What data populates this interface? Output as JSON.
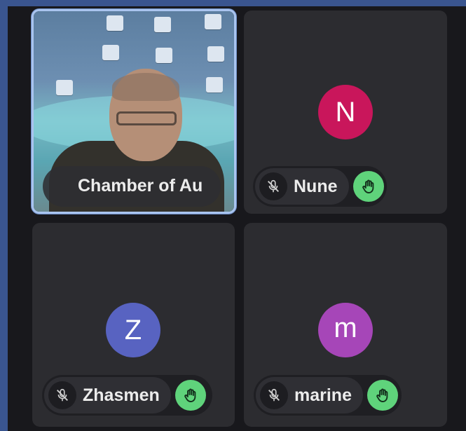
{
  "participants": [
    {
      "name": "Chamber of Au",
      "has_video": true,
      "active_speaker": true
    },
    {
      "name": "Nune",
      "initial": "N",
      "avatar_color": "#c9165b",
      "muted": true,
      "hand_raised": true
    },
    {
      "name": "Zhasmen",
      "initial": "Z",
      "avatar_color": "#5863c1",
      "muted": true,
      "hand_raised": true
    },
    {
      "name": "marine",
      "initial": "m",
      "avatar_color": "#a646b8",
      "muted": true,
      "hand_raised": true
    }
  ],
  "icons": {
    "mic": "mic-off-icon",
    "hand": "raised-hand-icon"
  },
  "colors": {
    "active_border": "#a9c4ef",
    "hand_badge": "#5fd37b",
    "tile_bg": "#2c2c30"
  }
}
